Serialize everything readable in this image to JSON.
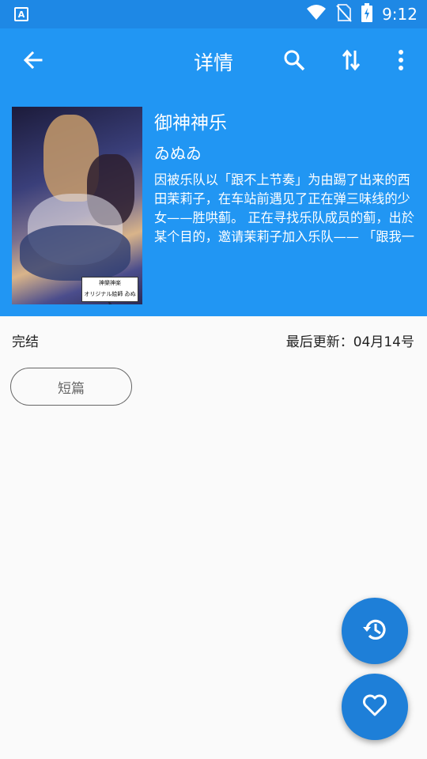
{
  "status_bar": {
    "left_icon": "A",
    "time": "9:12",
    "icons": [
      "wifi-icon",
      "no-sim-icon",
      "battery-charging-icon"
    ]
  },
  "toolbar": {
    "title": "详情",
    "icons": [
      "back-arrow-icon",
      "search-icon",
      "sort-icon",
      "more-vert-icon"
    ]
  },
  "book": {
    "title": "御神神乐",
    "author": "ゐぬゐ",
    "description": "因被乐队以「跟不上节奏」为由踢了出来的西田茉莉子，在车站前遇见了正在弹三味线的少女——胜哄蓟。 正在寻找乐队成员的蓟，出於某个目的，邀请茉莉子加入乐队—— 「跟我一起吧！成为高额纳…",
    "cover_label_line1": "神樂神楽",
    "cover_label_line2": "オリジナル絵師 ゐぬゐ"
  },
  "info": {
    "status": "完结",
    "last_update": "最后更新：04月14号"
  },
  "tags": [
    "短篇"
  ],
  "fabs": [
    "history-icon",
    "favorite-heart-icon"
  ],
  "colors": {
    "primary": "#2196f3",
    "status_bar": "#1e88e5",
    "fab": "#1e7fd8",
    "background": "#fafafa"
  }
}
